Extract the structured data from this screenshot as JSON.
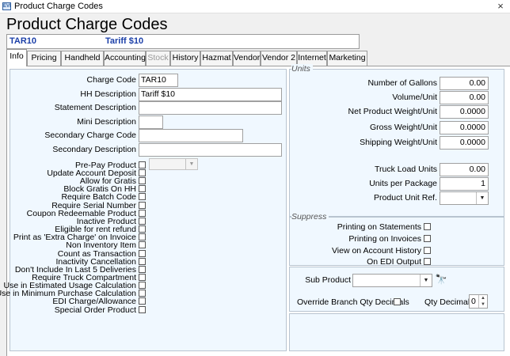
{
  "window": {
    "title": "Product Charge Codes",
    "app_icon": "EVI",
    "close_glyph": "×"
  },
  "page": {
    "title": "Product Charge Codes"
  },
  "info_bar": {
    "code": "TAR10",
    "description": "Tariff $10"
  },
  "tabs": [
    "Info",
    "Pricing",
    "Handheld",
    "Accounting",
    "Stock",
    "History",
    "Hazmat",
    "Vendor",
    "Vendor 2",
    "Internet",
    "Marketing"
  ],
  "left": {
    "charge_code": {
      "label": "Charge Code",
      "value": "TAR10"
    },
    "hh_description": {
      "label": "HH Description",
      "value": "Tariff $10"
    },
    "statement_description": {
      "label": "Statement Description",
      "value": ""
    },
    "mini_description": {
      "label": "Mini Description",
      "value": ""
    },
    "secondary_charge_code": {
      "label": "Secondary Charge Code",
      "value": ""
    },
    "secondary_description": {
      "label": "Secondary Description",
      "value": ""
    },
    "prepay_product": {
      "label": "Pre-Pay Product",
      "combo_value": ""
    },
    "checkboxes": [
      "Update Account Deposit",
      "Allow for Gratis",
      "Block Gratis On HH",
      "Require Batch Code",
      "Require Serial Number",
      "Coupon Redeemable Product",
      "Inactive Product",
      "Eligible for rent refund",
      "Print as 'Extra Charge' on Invoice",
      "Non Inventory Item",
      "Count as Transaction",
      "Inactivity Cancellation",
      "Don't Include In Last 5 Deliveries",
      "Require Truck Compartment",
      "Use in Estimated Usage Calculation",
      "Use in Minimum Purchase Calculation",
      "EDI Charge/Allowance",
      "Special Order Product"
    ]
  },
  "units": {
    "section_title": "Units",
    "fields": [
      {
        "label": "Number of Gallons",
        "value": "0.00"
      },
      {
        "label": "Volume/Unit",
        "value": "0.00"
      },
      {
        "label": "Net Product Weight/Unit",
        "value": "0.0000"
      },
      {
        "label": "Gross Weight/Unit",
        "value": "0.0000"
      },
      {
        "label": "Shipping Weight/Unit",
        "value": "0.0000"
      }
    ],
    "truck_load_units": {
      "label": "Truck Load Units",
      "value": "0.00"
    },
    "units_per_package": {
      "label": "Units per Package",
      "value": "1"
    },
    "product_unit_ref": {
      "label": "Product Unit Ref.",
      "value": ""
    }
  },
  "suppress": {
    "section_title": "Suppress",
    "items": [
      "Printing on Statements",
      "Printing on Invoices",
      "View on Account History",
      "On EDI Output"
    ]
  },
  "sub_product": {
    "label": "Sub Product",
    "value": "",
    "override_label": "Override Branch Qty Decimals",
    "qty_decimals_label": "Qty Decimals",
    "qty_decimals_value": "0"
  },
  "glyphs": {
    "dropdown": "▼",
    "binoculars": "🔭",
    "spin_up": "▲",
    "spin_down": "▼"
  }
}
